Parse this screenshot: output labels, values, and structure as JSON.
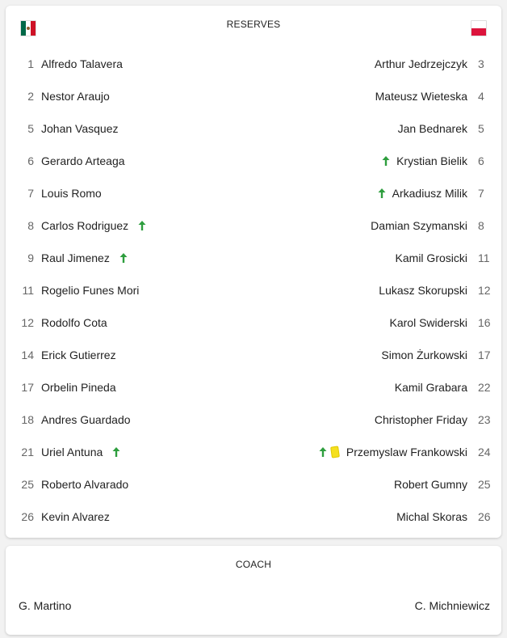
{
  "reserves": {
    "title": "RESERVES",
    "home_flag": {
      "icon": "mexico-flag-icon",
      "colors": [
        "#006847",
        "#ffffff",
        "#ce1126"
      ]
    },
    "away_flag": {
      "icon": "poland-flag-icon",
      "colors": [
        "#ffffff",
        "#dc143c"
      ]
    },
    "home": [
      {
        "number": "1",
        "name": "Alfredo Talavera",
        "sub": false,
        "yellow": false
      },
      {
        "number": "2",
        "name": "Nestor Araujo",
        "sub": false,
        "yellow": false
      },
      {
        "number": "5",
        "name": "Johan Vasquez",
        "sub": false,
        "yellow": false
      },
      {
        "number": "6",
        "name": "Gerardo Arteaga",
        "sub": false,
        "yellow": false
      },
      {
        "number": "7",
        "name": "Louis Romo",
        "sub": false,
        "yellow": false
      },
      {
        "number": "8",
        "name": "Carlos Rodriguez",
        "sub": true,
        "yellow": false
      },
      {
        "number": "9",
        "name": "Raul Jimenez",
        "sub": true,
        "yellow": false
      },
      {
        "number": "11",
        "name": "Rogelio Funes Mori",
        "sub": false,
        "yellow": false
      },
      {
        "number": "12",
        "name": "Rodolfo Cota",
        "sub": false,
        "yellow": false
      },
      {
        "number": "14",
        "name": "Erick Gutierrez",
        "sub": false,
        "yellow": false
      },
      {
        "number": "17",
        "name": "Orbelin Pineda",
        "sub": false,
        "yellow": false
      },
      {
        "number": "18",
        "name": "Andres Guardado",
        "sub": false,
        "yellow": false
      },
      {
        "number": "21",
        "name": "Uriel Antuna",
        "sub": true,
        "yellow": false
      },
      {
        "number": "25",
        "name": "Roberto Alvarado",
        "sub": false,
        "yellow": false
      },
      {
        "number": "26",
        "name": "Kevin Alvarez",
        "sub": false,
        "yellow": false
      }
    ],
    "away": [
      {
        "number": "3",
        "name": "Arthur Jedrzejczyk",
        "sub": false,
        "yellow": false
      },
      {
        "number": "4",
        "name": "Mateusz Wieteska",
        "sub": false,
        "yellow": false
      },
      {
        "number": "5",
        "name": "Jan Bednarek",
        "sub": false,
        "yellow": false
      },
      {
        "number": "6",
        "name": "Krystian Bielik",
        "sub": true,
        "yellow": false
      },
      {
        "number": "7",
        "name": "Arkadiusz Milik",
        "sub": true,
        "yellow": false
      },
      {
        "number": "8",
        "name": "Damian Szymanski",
        "sub": false,
        "yellow": false
      },
      {
        "number": "11",
        "name": "Kamil Grosicki",
        "sub": false,
        "yellow": false
      },
      {
        "number": "12",
        "name": "Lukasz Skorupski",
        "sub": false,
        "yellow": false
      },
      {
        "number": "16",
        "name": "Karol Swiderski",
        "sub": false,
        "yellow": false
      },
      {
        "number": "17",
        "name": "Simon Żurkowski",
        "sub": false,
        "yellow": false
      },
      {
        "number": "22",
        "name": "Kamil Grabara",
        "sub": false,
        "yellow": false
      },
      {
        "number": "23",
        "name": "Christopher Friday",
        "sub": false,
        "yellow": false
      },
      {
        "number": "24",
        "name": "Przemyslaw Frankowski",
        "sub": true,
        "yellow": true
      },
      {
        "number": "25",
        "name": "Robert Gumny",
        "sub": false,
        "yellow": false
      },
      {
        "number": "26",
        "name": "Michal Skoras",
        "sub": false,
        "yellow": false
      }
    ]
  },
  "coach": {
    "title": "COACH",
    "home": "G. Martino",
    "away": "C. Michniewicz"
  },
  "colors": {
    "sub_arrow": "#2e9e3e",
    "yellow_card": "#f5e01f"
  }
}
